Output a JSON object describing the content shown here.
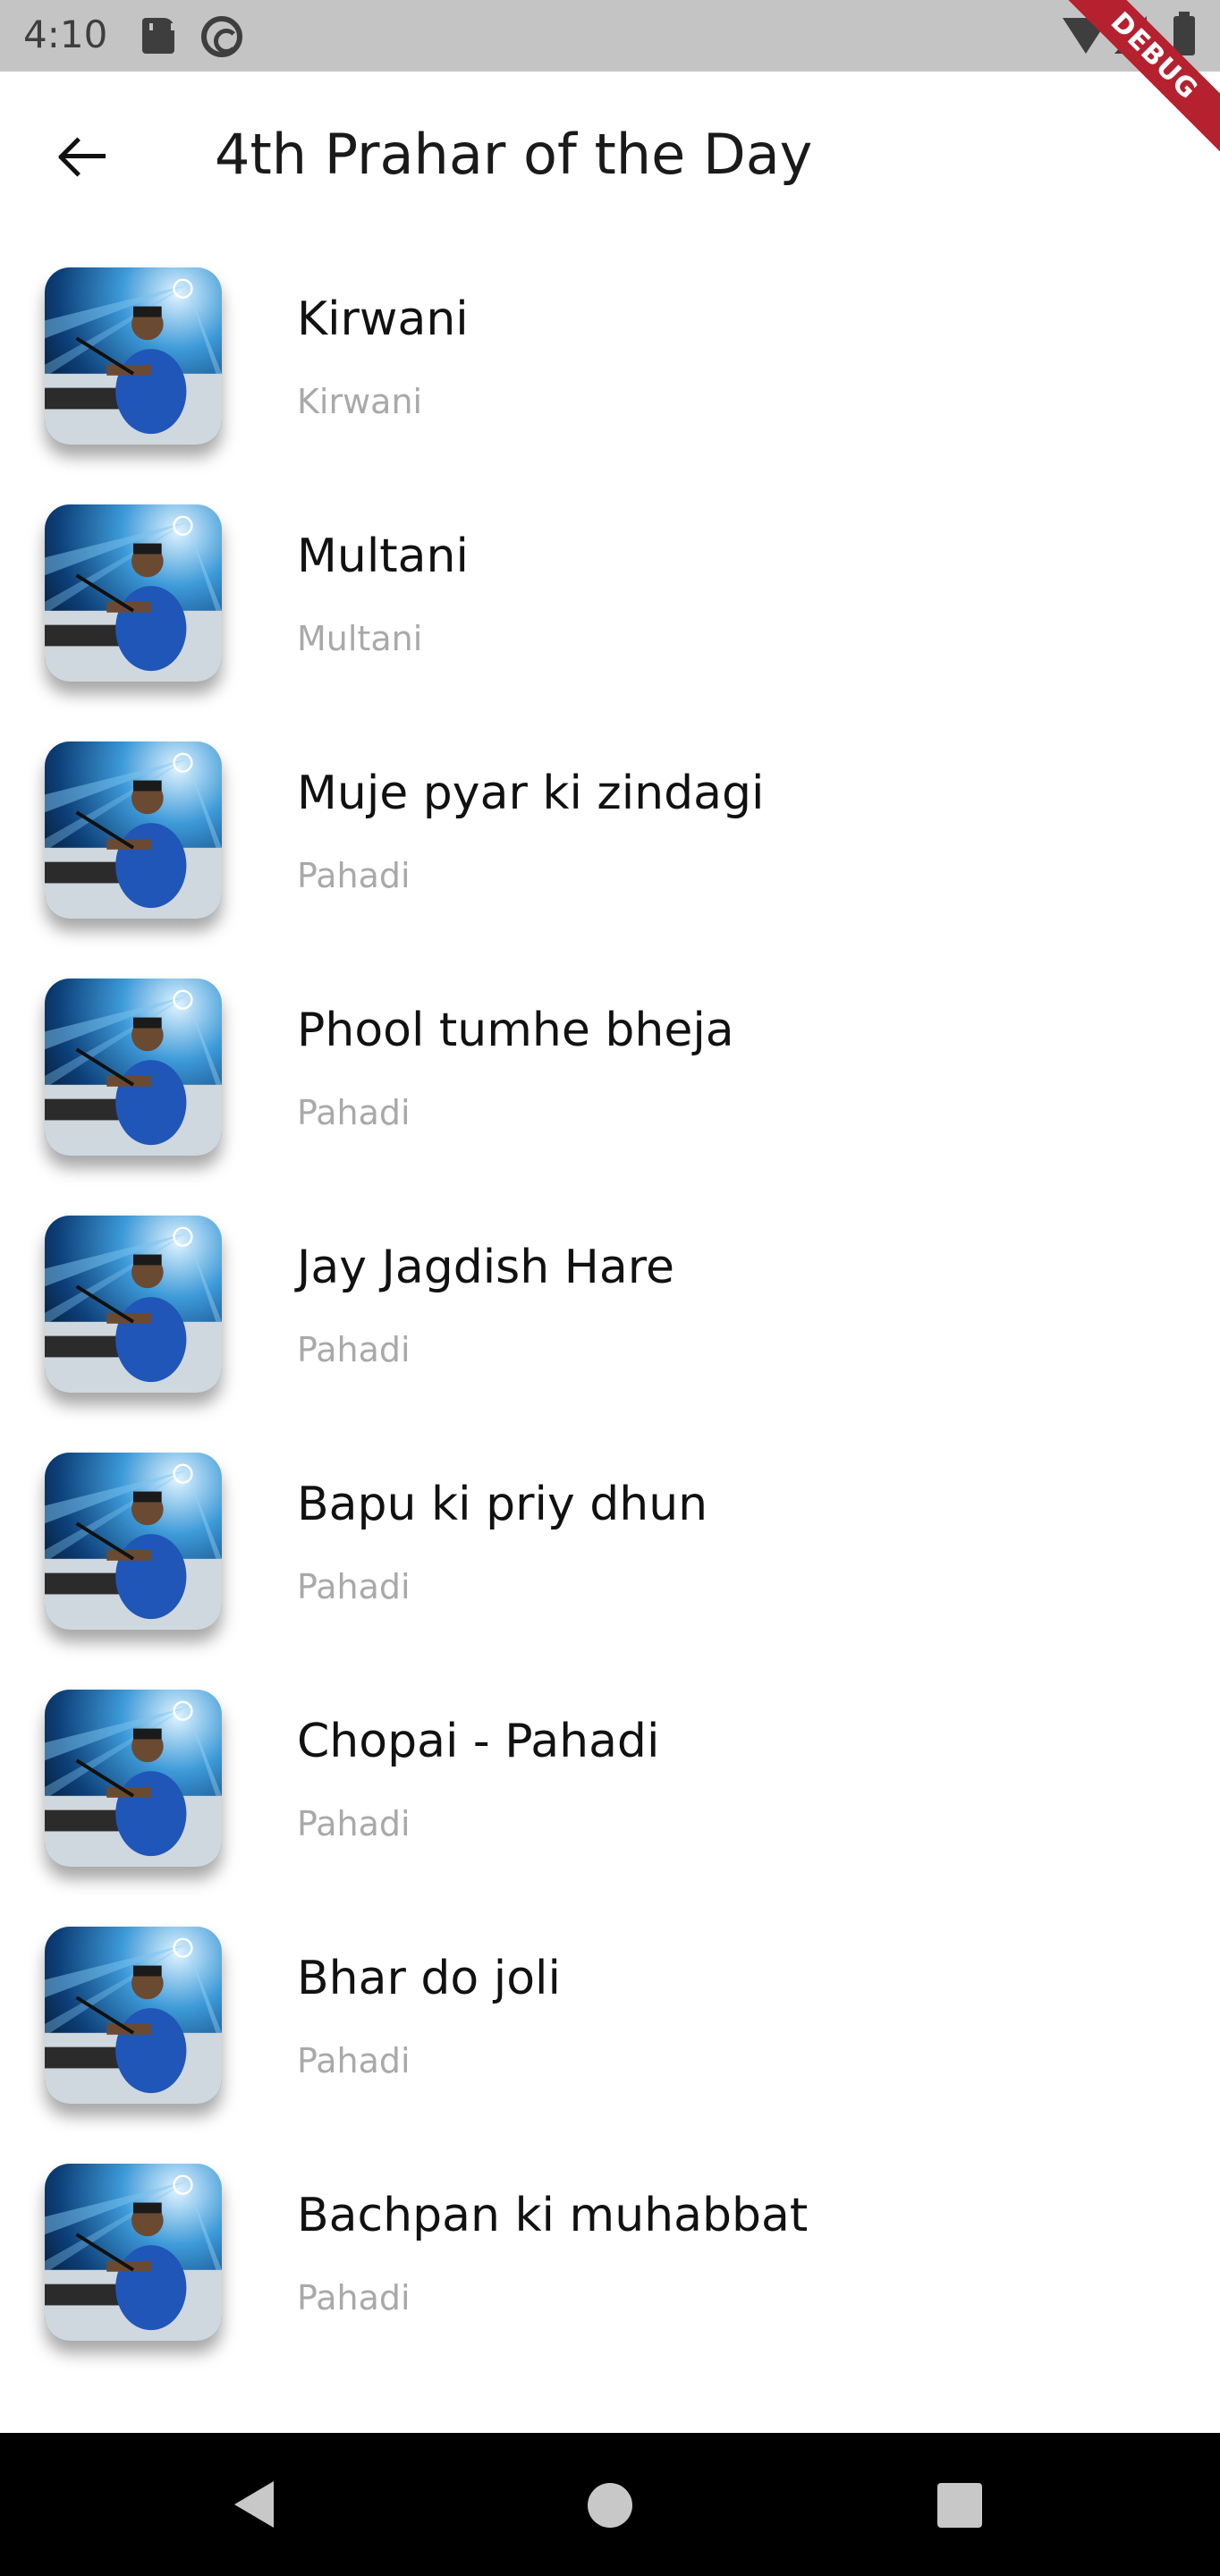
{
  "status_bar": {
    "time": "4:10",
    "icons": [
      "sd-card-icon",
      "sync-icon",
      "wifi-icon",
      "signal-icon",
      "battery-icon"
    ]
  },
  "debug_banner": "DEBUG",
  "app_bar": {
    "back_icon": "arrow-left-icon",
    "title": "4th Prahar of the Day"
  },
  "songs": [
    {
      "title": "Kirwani",
      "subtitle": "Kirwani"
    },
    {
      "title": "Multani",
      "subtitle": "Multani"
    },
    {
      "title": "Muje pyar ki zindagi",
      "subtitle": "Pahadi"
    },
    {
      "title": "Phool tumhe bheja",
      "subtitle": "Pahadi"
    },
    {
      "title": "Jay Jagdish Hare",
      "subtitle": "Pahadi"
    },
    {
      "title": "Bapu ki priy dhun",
      "subtitle": "Pahadi"
    },
    {
      "title": "Chopai - Pahadi",
      "subtitle": "Pahadi"
    },
    {
      "title": "Bhar do joli",
      "subtitle": "Pahadi"
    },
    {
      "title": "Bachpan ki muhabbat",
      "subtitle": "Pahadi"
    }
  ],
  "nav_bar": {
    "icons": [
      "nav-back-icon",
      "nav-home-icon",
      "nav-recents-icon"
    ]
  },
  "colors": {
    "status_bar_bg": "#c4c4c4",
    "subtitle": "#a9a9a9",
    "debug_banner": "#b5212f",
    "thumb_blue": "#1b5fa8"
  }
}
